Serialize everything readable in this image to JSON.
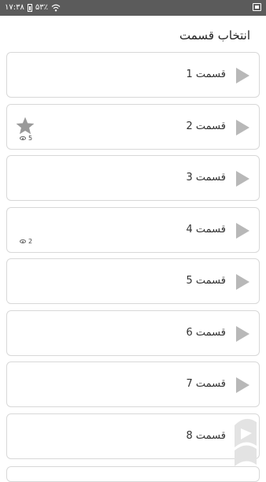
{
  "status_bar": {
    "time": "۱۷:۳۸",
    "battery_percent": "۵۳٪",
    "icons": [
      "battery-icon",
      "wifi-icon",
      "gallery-icon"
    ]
  },
  "header": {
    "title": "انتخاب قسمت"
  },
  "episodes": [
    {
      "label": "قسمت 1",
      "rated": false,
      "views": ""
    },
    {
      "label": "قسمت 2",
      "rated": true,
      "views": "5"
    },
    {
      "label": "قسمت 3",
      "rated": false,
      "views": ""
    },
    {
      "label": "قسمت 4",
      "rated": false,
      "views": "2"
    },
    {
      "label": "قسمت 5",
      "rated": false,
      "views": ""
    },
    {
      "label": "قسمت 6",
      "rated": false,
      "views": ""
    },
    {
      "label": "قسمت 7",
      "rated": false,
      "views": ""
    },
    {
      "label": "قسمت 8",
      "rated": false,
      "views": ""
    }
  ],
  "colors": {
    "statusbar": "#5b5b5b",
    "play_icon": "#b8b8b8",
    "star": "#9a9a9a",
    "border": "#d8d8d8"
  }
}
